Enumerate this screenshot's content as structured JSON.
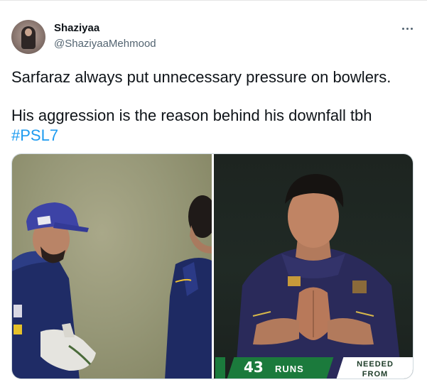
{
  "tweet": {
    "author_name": "Shaziyaa",
    "author_handle": "@ShaziyaaMehmood",
    "text_line_1": "Sarfaraz always put unnecessary pressure on bowlers.",
    "text_line_2": "His aggression is the reason behind his downfall tbh",
    "hashtag": "#PSL7",
    "more_icon": "more-horizontal-icon"
  },
  "media": {
    "scoreboard": {
      "runs_value": "43",
      "runs_label": "RUNS",
      "needed_line_1": "NEEDED",
      "needed_line_2": "FROM"
    }
  },
  "colors": {
    "link": "#1d9bf0",
    "secondary_text": "#536471",
    "primary_text": "#0f1419",
    "scoreboard_green": "#1b7a3c"
  }
}
